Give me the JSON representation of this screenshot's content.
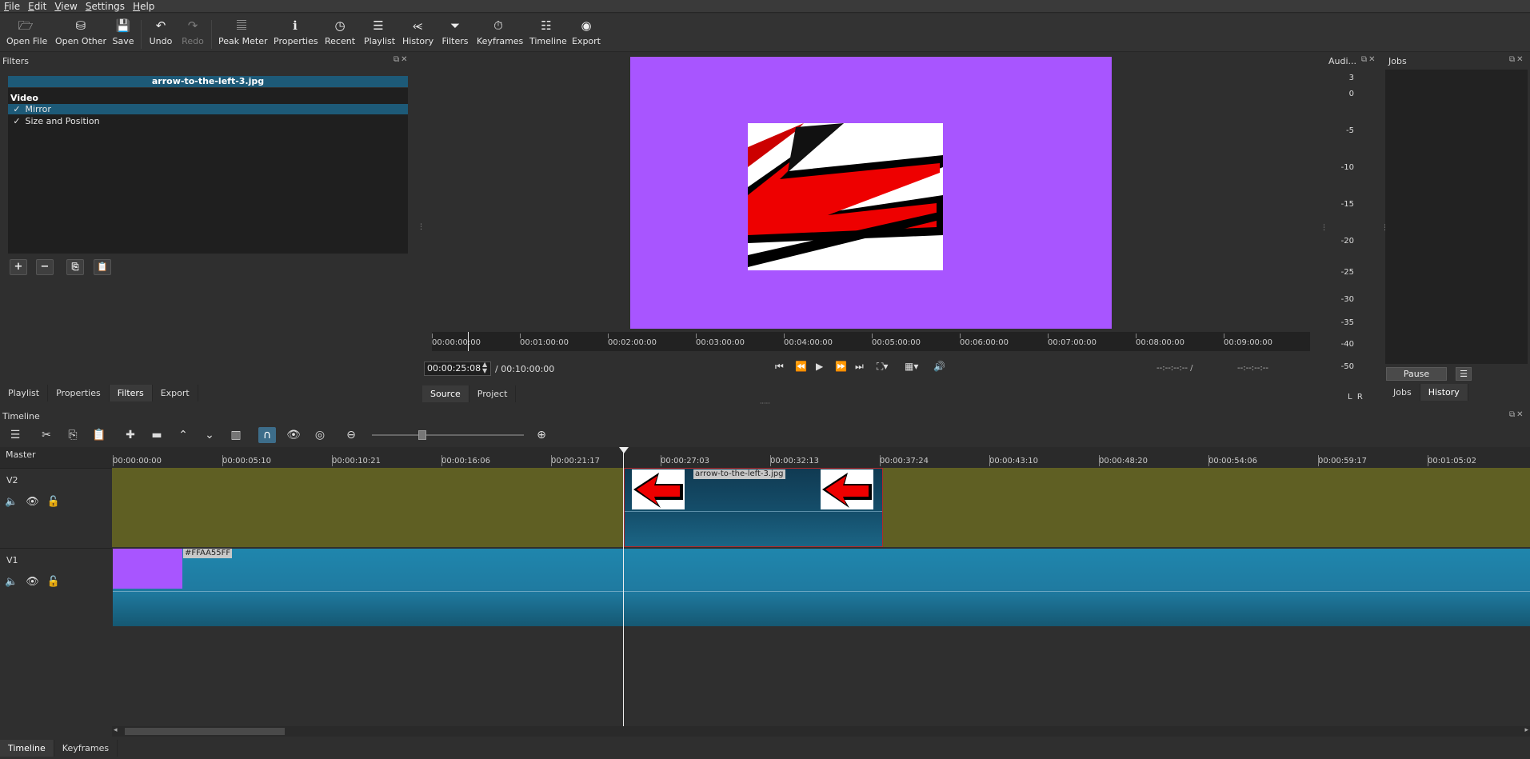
{
  "menu": [
    "File",
    "Edit",
    "View",
    "Settings",
    "Help"
  ],
  "toolbar": {
    "open_file": "Open File",
    "open_other": "Open Other",
    "save": "Save",
    "undo": "Undo",
    "redo": "Redo",
    "peak_meter": "Peak Meter",
    "properties": "Properties",
    "recent": "Recent",
    "playlist": "Playlist",
    "history": "History",
    "filters": "Filters",
    "keyframes": "Keyframes",
    "timeline": "Timeline",
    "export": "Export"
  },
  "filters_panel": {
    "title": "Filters",
    "clip_name": "arrow-to-the-left-3.jpg",
    "section": "Video",
    "items": [
      {
        "label": "Mirror",
        "checked": "✓",
        "selected": true
      },
      {
        "label": "Size and Position",
        "checked": "✓",
        "selected": false
      }
    ]
  },
  "left_tabs": [
    "Playlist",
    "Properties",
    "Filters",
    "Export"
  ],
  "player": {
    "ruler_ticks": [
      "00:00:00:00",
      "00:01:00:00",
      "00:02:00:00",
      "00:03:00:00",
      "00:04:00:00",
      "00:05:00:00",
      "00:06:00:00",
      "00:07:00:00",
      "00:08:00:00",
      "00:09:00:00"
    ],
    "timecode": "00:00:25:08",
    "duration": "/ 00:10:00:00",
    "in_point": "--:--:--:-- /",
    "out_point": "--:--:--:--",
    "tabs": [
      "Source",
      "Project"
    ],
    "background_color": "#a855ff"
  },
  "audio_meter": {
    "title": "Audi...",
    "scale": [
      "3",
      "0",
      "-5",
      "-10",
      "-15",
      "-20",
      "-25",
      "-30",
      "-35",
      "-40",
      "-50"
    ],
    "channels": "L  R"
  },
  "jobs": {
    "title": "Jobs",
    "pause": "Pause",
    "tabs": [
      "Jobs",
      "History"
    ]
  },
  "timeline": {
    "title": "Timeline",
    "master": "Master",
    "ruler_ticks": [
      "00:00:00:00",
      "00:00:05:10",
      "00:00:10:21",
      "00:00:16:06",
      "00:00:21:17",
      "00:00:27:03",
      "00:00:32:13",
      "00:00:37:24",
      "00:00:43:10",
      "00:00:48:20",
      "00:00:54:06",
      "00:00:59:17",
      "00:01:05:02"
    ],
    "tracks": [
      {
        "name": "V2",
        "clip_label": "arrow-to-the-left-3.jpg"
      },
      {
        "name": "V1",
        "clip_label": "#FFAA55FF"
      }
    ],
    "v1_color": "#a855ff",
    "v2_track_color": "#5f5f23"
  },
  "bottom_tabs": [
    "Timeline",
    "Keyframes"
  ]
}
